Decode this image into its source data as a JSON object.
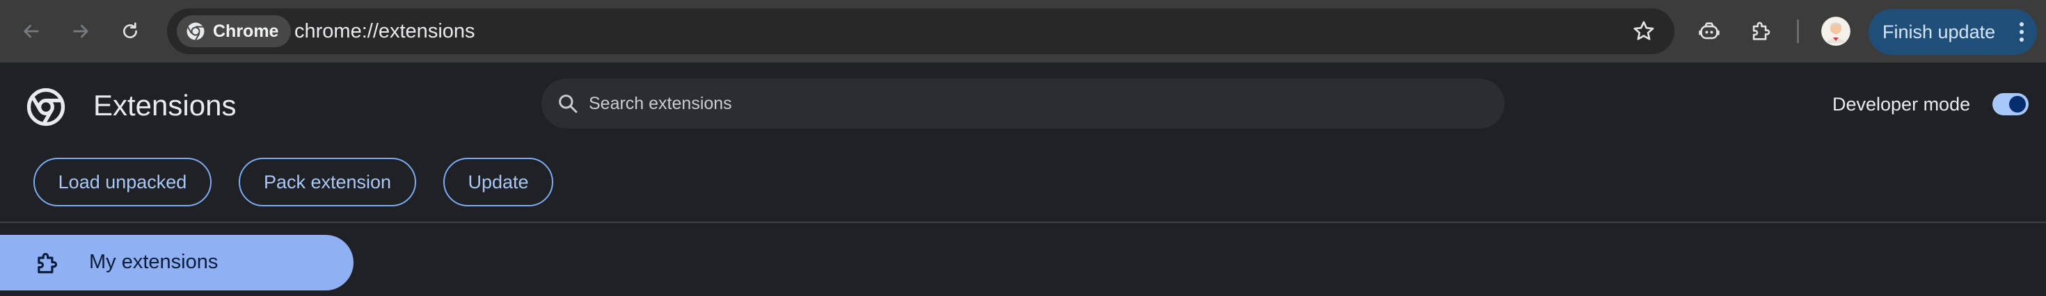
{
  "browser": {
    "chip_label": "Chrome",
    "url": "chrome://extensions",
    "finish_update_label": "Finish update",
    "icons": {
      "back": "arrow-left-icon",
      "forward": "arrow-right-icon",
      "reload": "reload-icon",
      "bookmark": "star-icon",
      "copilot": "robot-icon",
      "extensions": "puzzle-icon",
      "profile": "avatar",
      "menu": "kebab-icon"
    }
  },
  "header": {
    "title": "Extensions",
    "search_placeholder": "Search extensions",
    "developer_mode_label": "Developer mode",
    "developer_mode_on": true
  },
  "dev_buttons": {
    "load_unpacked": "Load unpacked",
    "pack_extension": "Pack extension",
    "update": "Update"
  },
  "sidebar": {
    "items": [
      {
        "label": "My extensions",
        "selected": true
      }
    ]
  },
  "colors": {
    "toolbar_bg": "#3c3c3c",
    "page_bg": "#202124",
    "accent": "#a8c7fa",
    "update_button_bg": "#1f4e79",
    "selected_item_bg": "#8fb0f2"
  }
}
